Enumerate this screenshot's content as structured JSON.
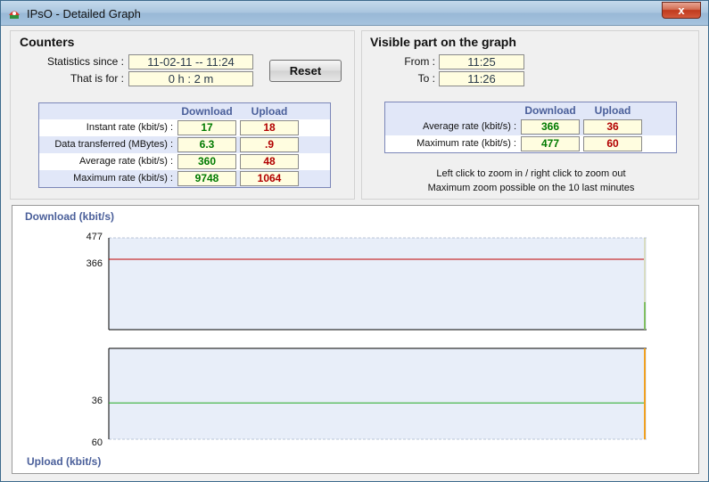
{
  "window": {
    "title": "IPsO - Detailed Graph",
    "close_label": "x"
  },
  "counters": {
    "title": "Counters",
    "stats_since_label": "Statistics since :",
    "stats_since_value": "11-02-11 -- 11:24",
    "that_is_for_label": "That is for :",
    "that_is_for_value": "0 h : 2 m",
    "reset_label": "Reset",
    "col_download": "Download",
    "col_upload": "Upload",
    "rows": [
      {
        "label": "Instant rate (kbit/s) :",
        "download": "17",
        "upload": "18"
      },
      {
        "label": "Data transferred (MBytes) :",
        "download": "6.3",
        "upload": ".9"
      },
      {
        "label": "Average rate (kbit/s) :",
        "download": "360",
        "upload": "48"
      },
      {
        "label": "Maximum rate (kbit/s) :",
        "download": "9748",
        "upload": "1064"
      }
    ]
  },
  "visible": {
    "title": "Visible part on the graph",
    "from_label": "From :",
    "from_value": "11:25",
    "to_label": "To :",
    "to_value": "11:26",
    "col_download": "Download",
    "col_upload": "Upload",
    "rows": [
      {
        "label": "Average rate (kbit/s) :",
        "download": "366",
        "upload": "36"
      },
      {
        "label": "Maximum rate (kbit/s) :",
        "download": "477",
        "upload": "60"
      }
    ],
    "hint_1": "Left click to zoom in / right click to zoom out",
    "hint_2": "Maximum zoom possible on the 10 last minutes"
  },
  "graph": {
    "download_title": "Download  (kbit/s)",
    "upload_title": "Upload (kbit/s)",
    "download_max_label": "477",
    "download_avg_label": "366",
    "upload_avg_label": "36",
    "upload_max_label": "60",
    "download_max": 477,
    "download_avg": 366,
    "upload_max": 60,
    "upload_avg": 36,
    "colors": {
      "plot_bg": "#e8eef9",
      "download_avg_line": "#c00000",
      "upload_avg_line": "#22aa22",
      "download_bar": "#36b336",
      "upload_bar": "#f0a020"
    }
  }
}
